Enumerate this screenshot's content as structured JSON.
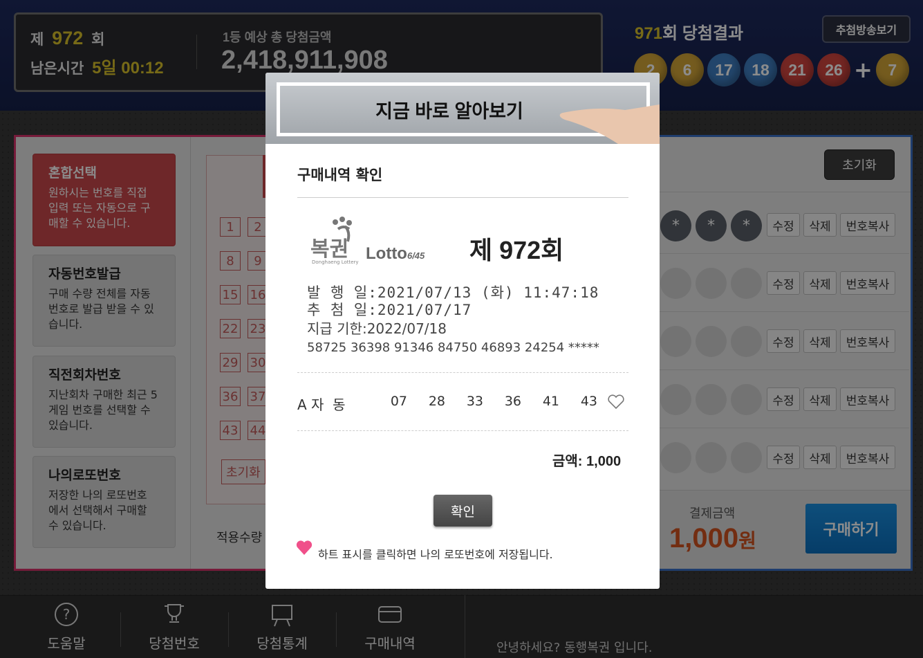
{
  "header": {
    "round_prefix": "제",
    "round_number": "972",
    "round_suffix": "회",
    "remaining_label": "남은시간",
    "remaining_value": "5일 00:12",
    "jackpot_label": "1등 예상 총 당첨금액",
    "jackpot_value": "2,418,911,908",
    "prev_round": "971",
    "prev_results_label": "회 당첨결과",
    "broadcast_button": "추첨방송보기",
    "winning_numbers": [
      "2",
      "6",
      "17",
      "18",
      "21",
      "26"
    ],
    "bonus_number": "7",
    "ball_colors": [
      "#d4a638",
      "#d4a638",
      "#3f7fc4",
      "#3f7fc4",
      "#d2453f",
      "#d2453f",
      "#d4a638"
    ]
  },
  "sidebar": {
    "items": [
      {
        "title": "혼합선택",
        "desc": "원하시는 번호를 직접 입력 또는 자동으로 구매할 수 있습니다."
      },
      {
        "title": "자동번호발급",
        "desc": "구매 수량 전체를 자동 번호로 발급 받을 수 있습니다."
      },
      {
        "title": "직전회차번호",
        "desc": "지난회차 구매한 최근 5게임 번호를 선택할 수 있습니다."
      },
      {
        "title": "나의로또번호",
        "desc": "저장한 나의 로또번호 에서 선택해서 구매할 수 있습니다."
      }
    ]
  },
  "grid": {
    "col1": [
      "1",
      "8",
      "15",
      "22",
      "29",
      "36",
      "43"
    ],
    "col2": [
      "2",
      "9",
      "16",
      "23",
      "30",
      "37",
      "44"
    ],
    "reset_label": "초기화",
    "apply_label": "적용수량"
  },
  "rows": {
    "reset_button": "초기화",
    "edit": "수정",
    "delete": "삭제",
    "copy": "번호복사",
    "star": "*"
  },
  "payment": {
    "label": "결제금액",
    "amount": "1,000",
    "unit": "원",
    "buy_button": "구매하기"
  },
  "footer": {
    "items": [
      "도움말",
      "당첨번호",
      "당첨통계",
      "구매내역"
    ],
    "greeting": "안녕하세요? 동행복권 입니다."
  },
  "modal": {
    "banner": "지금 바로 알아보기",
    "title": "구매내역 확인",
    "logo_text": "복권",
    "logo_sub": "Donghaeng Lottery",
    "lotto_text": "Lotto",
    "lotto_sub": "6/45",
    "round": "제 972회",
    "issue_label": "발 행 일",
    "issue_value": ":2021/07/13 (화) 11:47:18",
    "draw_label": "추 첨 일",
    "draw_value": ":2021/07/17",
    "deadline_label": "지급 기한",
    "deadline_value": ":2022/07/18",
    "serial": "58725 36398 91346 84750 46893 24254 *****",
    "game_label": "A 자  동",
    "game_numbers": [
      "07",
      "28",
      "33",
      "36",
      "41",
      "43"
    ],
    "amount_label": "금액:",
    "amount_value": "1,000",
    "confirm": "확인",
    "note": "하트 표시를 클릭하면 나의 로또번호에 저장됩니다."
  }
}
